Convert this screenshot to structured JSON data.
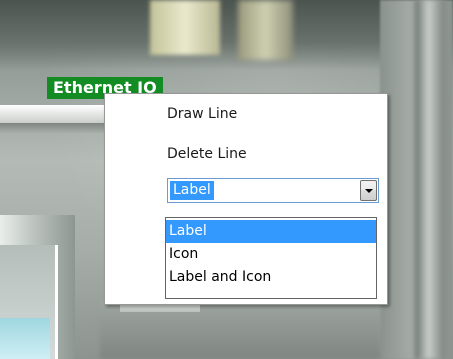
{
  "canvas_tag": {
    "label": "Ethernet IO"
  },
  "context_menu": {
    "items": [
      {
        "label": "Draw Line"
      },
      {
        "label": "Delete Line"
      }
    ],
    "display_mode": {
      "selected": "Label",
      "options": [
        "Label",
        "Icon",
        "Label and Icon"
      ],
      "highlighted_index": 0,
      "expanded": true
    }
  },
  "colors": {
    "tag_background": "#138c24",
    "selection_highlight": "#3399ff",
    "combo_border": "#6b9bd1"
  },
  "icons": {
    "dropdown": "chevron-down-icon"
  }
}
